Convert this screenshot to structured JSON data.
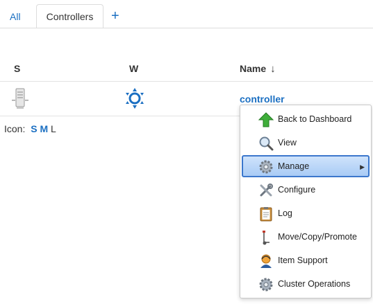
{
  "tabs": {
    "all": "All",
    "active": "Controllers",
    "add": "+"
  },
  "table": {
    "headers": {
      "s": "S",
      "w": "W",
      "name": "Name",
      "sort_arrow": "↓"
    },
    "row": {
      "name": "controller",
      "status_icon": "computer-icon",
      "weather_icon": "sunny-weather-icon"
    }
  },
  "icon_size": {
    "label": "Icon:",
    "small": "S",
    "medium": "M",
    "large": "L"
  },
  "context_menu": {
    "items": [
      {
        "label": "Back to Dashboard",
        "icon": "green-up-arrow-icon"
      },
      {
        "label": "View",
        "icon": "magnifier-icon"
      },
      {
        "label": "Manage",
        "icon": "gear-icon",
        "highlighted": true,
        "submenu": "▶"
      },
      {
        "label": "Configure",
        "icon": "tools-icon"
      },
      {
        "label": "Log",
        "icon": "clipboard-icon"
      },
      {
        "label": "Move/Copy/Promote",
        "icon": "hand-truck-icon"
      },
      {
        "label": "Item Support",
        "icon": "support-agent-icon"
      },
      {
        "label": "Cluster Operations",
        "icon": "gear-icon"
      }
    ]
  },
  "colors": {
    "link": "#1b6fc2",
    "highlight_border": "#3b77cc",
    "highlight_fill": "#a9cbf5"
  }
}
